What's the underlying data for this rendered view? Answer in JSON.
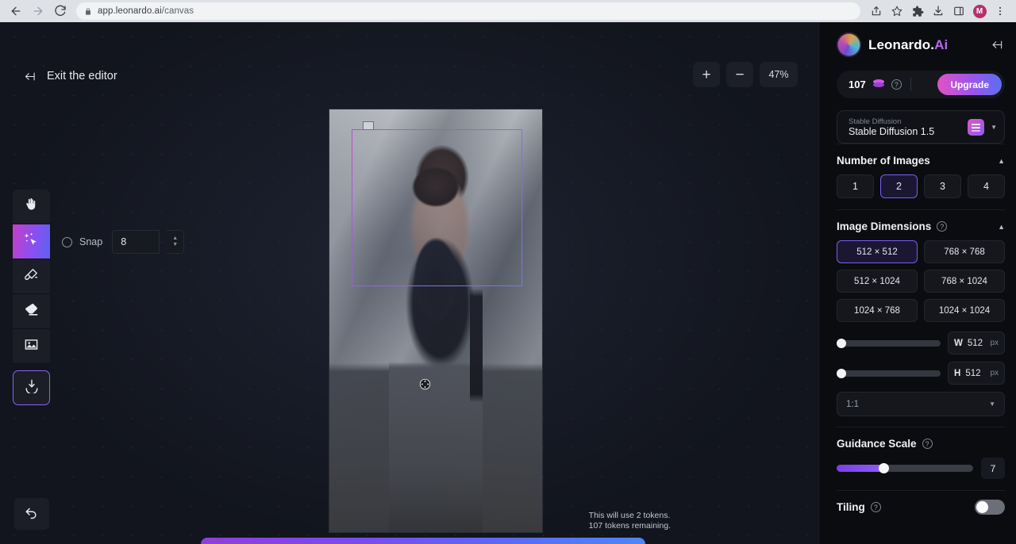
{
  "browser": {
    "url_host": "app.leonardo.ai",
    "url_path": "/canvas",
    "back_icon": "back-arrow-icon",
    "forward_icon": "forward-arrow-icon",
    "reload_icon": "reload-icon",
    "lock_icon": "lock-icon",
    "share_icon": "share-icon",
    "bookmark_icon": "star-icon",
    "extensions_icon": "puzzle-icon",
    "downloads_icon": "download-icon",
    "sidepanel_icon": "side-panel-icon",
    "profile_initial": "M",
    "menu_icon": "three-dot-menu-icon"
  },
  "canvas": {
    "exit_label": "Exit the editor",
    "exit_icon": "exit-arrow-icon",
    "zoom_in": "+",
    "zoom_out": "−",
    "zoom_level": "47%",
    "snap_label": "Snap",
    "snap_value": "8",
    "undo_icon": "undo-arrow-icon",
    "tools": [
      {
        "name": "hand-tool",
        "icon": "hand-icon",
        "active": false
      },
      {
        "name": "magic-select-tool",
        "icon": "magic-wand-cursor-icon",
        "active": true
      },
      {
        "name": "paint-tool",
        "icon": "paint-brush-icon",
        "active": false
      },
      {
        "name": "eraser-tool",
        "icon": "eraser-icon",
        "active": false
      },
      {
        "name": "image-upload-tool",
        "icon": "image-icon",
        "active": false
      },
      {
        "name": "download-tool",
        "icon": "download-icon",
        "active": false
      }
    ],
    "token_note_line1": "This will use 2 tokens.",
    "token_note_line2": "107 tokens remaining.",
    "move_cursor_icon": "move-cursor-icon"
  },
  "sidebar": {
    "brand_name": "Leonardo.",
    "brand_suffix": "Ai",
    "collapse_icon": "collapse-panel-icon",
    "credits": "107",
    "coin_icon": "coin-stack-icon",
    "help_icon": "help-circle-icon",
    "upgrade_label": "Upgrade",
    "model": {
      "category": "Stable Diffusion",
      "name": "Stable Diffusion 1.5",
      "thumb_icon": "model-thumbnail-icon",
      "caret_icon": "chevron-down-icon"
    },
    "number_of_images": {
      "title": "Number of Images",
      "chevron_icon": "chevron-up-icon",
      "options": [
        "1",
        "2",
        "3",
        "4"
      ],
      "selected": "2"
    },
    "image_dimensions": {
      "title": "Image Dimensions",
      "help_icon": "help-circle-icon",
      "chevron_icon": "chevron-up-icon",
      "options": [
        "512 × 512",
        "768 × 768",
        "512 × 1024",
        "768 × 1024",
        "1024 × 768",
        "1024 × 1024"
      ],
      "selected": "512 × 512",
      "width_key": "W",
      "width_value": "512",
      "height_key": "H",
      "height_value": "512",
      "unit": "px",
      "ratio": "1:1",
      "ratio_caret_icon": "chevron-down-icon"
    },
    "guidance_scale": {
      "title": "Guidance Scale",
      "help_icon": "help-circle-icon",
      "value": "7"
    },
    "tiling": {
      "title": "Tiling",
      "help_icon": "help-circle-icon",
      "enabled": false
    }
  },
  "colors": {
    "accent_purple": "#8b5cf6",
    "brand_pink": "#d256e8",
    "sidebar_bg": "#0b0c10",
    "canvas_bg": "#12151d"
  }
}
